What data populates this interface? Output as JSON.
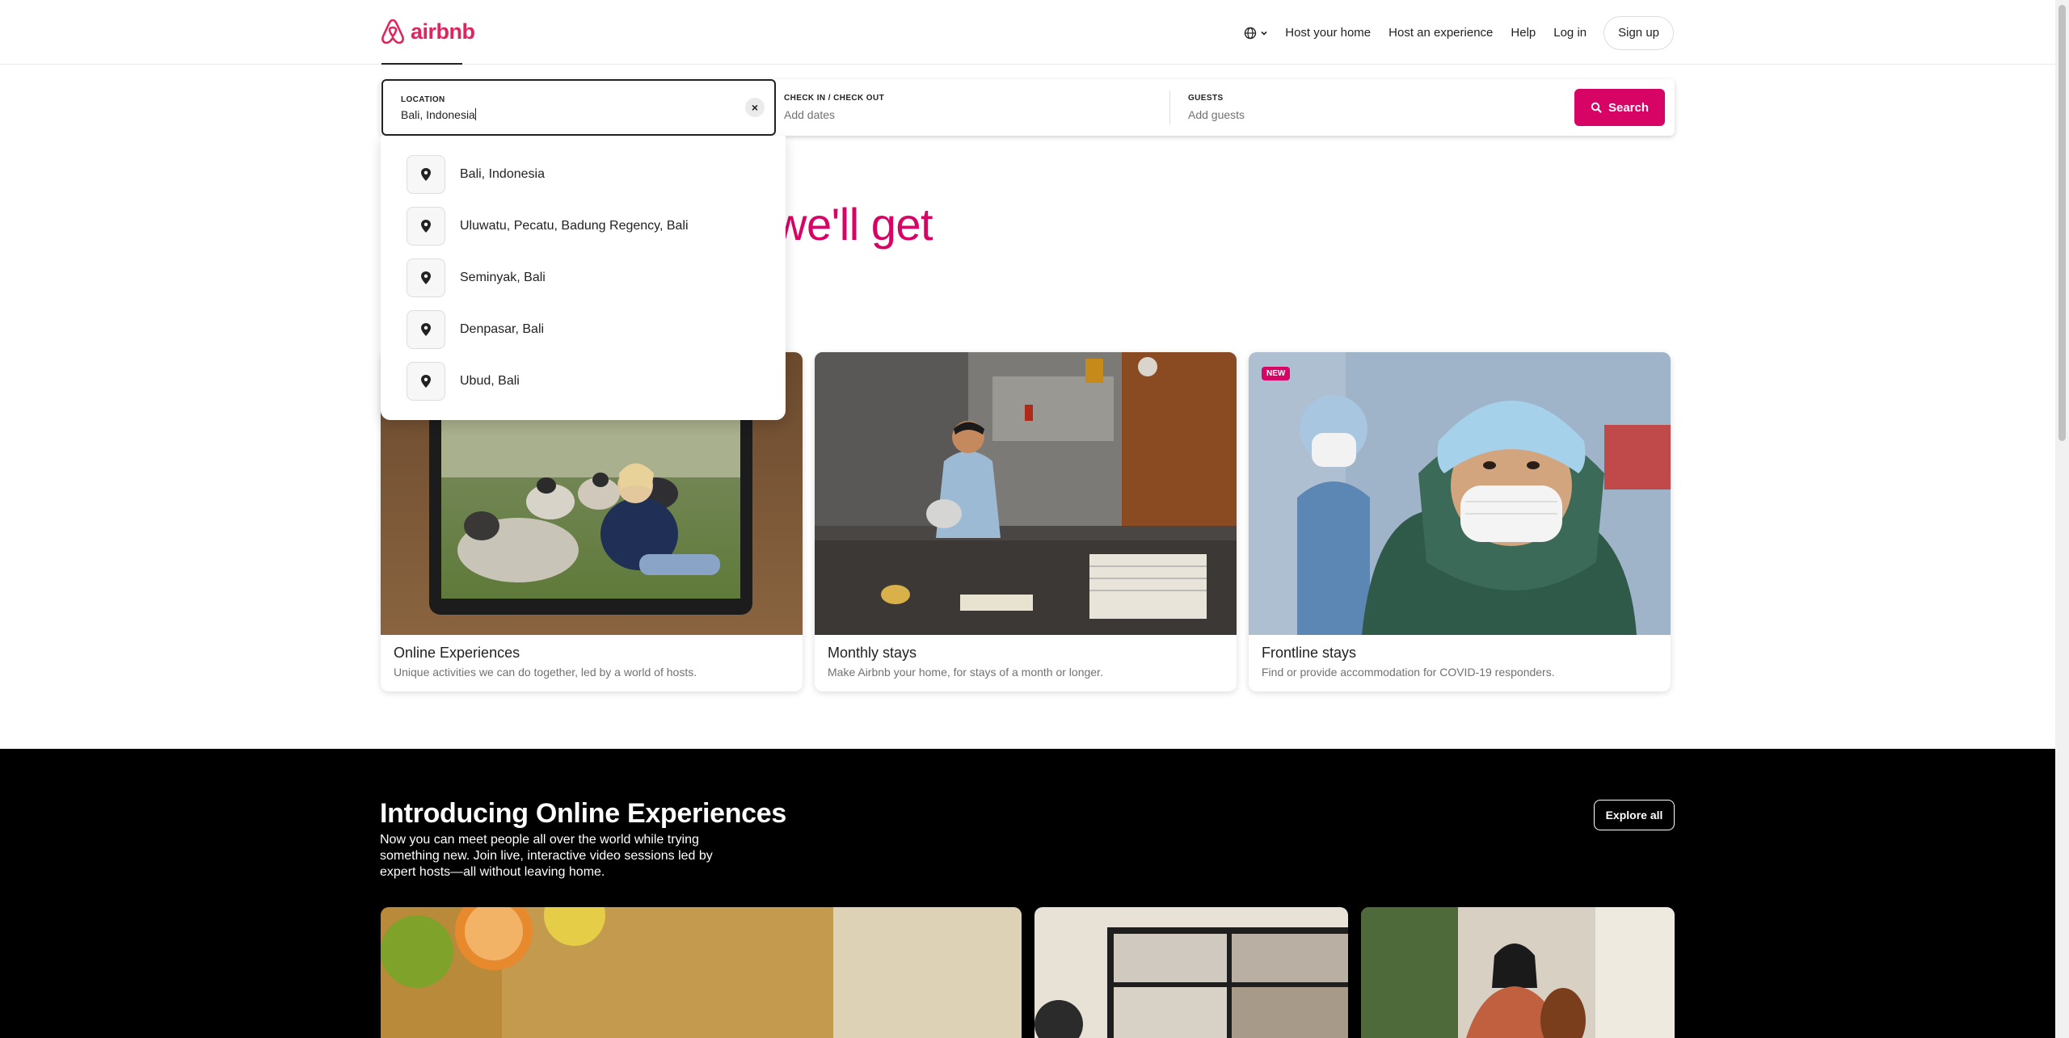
{
  "header": {
    "brand": "airbnb",
    "nav": {
      "host_home": "Host your home",
      "host_experience": "Host an experience",
      "help": "Help",
      "login": "Log in",
      "signup": "Sign up"
    },
    "brand_color": "#e0245e"
  },
  "search": {
    "location_label": "LOCATION",
    "location_value": "Bali, Indonesia",
    "dates_label": "CHECK IN / CHECK OUT",
    "dates_placeholder": "Add dates",
    "guests_label": "GUESTS",
    "guests_placeholder": "Add guests",
    "button_label": "Search",
    "button_color": "#d70466"
  },
  "suggestions": [
    "Bali, Indonesia",
    "Uluwatu, Pecatu, Badung Regency, Bali",
    "Seminyak, Bali",
    "Denpasar, Bali",
    "Ubud, Bali"
  ],
  "hero": {
    "partial_text": "we'll get"
  },
  "cards": [
    {
      "title": "Online Experiences",
      "subtitle": "Unique activities we can do together, led by a world of hosts."
    },
    {
      "title": "Monthly stays",
      "subtitle": "Make Airbnb your home, for stays of a month or longer."
    },
    {
      "title": "Frontline stays",
      "subtitle": "Find or provide accommodation for COVID-19 responders.",
      "badge": "NEW"
    }
  ],
  "online_experiences": {
    "title": "Introducing Online Experiences",
    "description": "Now you can meet people all over the world while trying something new. Join live, interactive video sessions led by expert hosts—all without leaving home.",
    "explore_label": "Explore all"
  }
}
